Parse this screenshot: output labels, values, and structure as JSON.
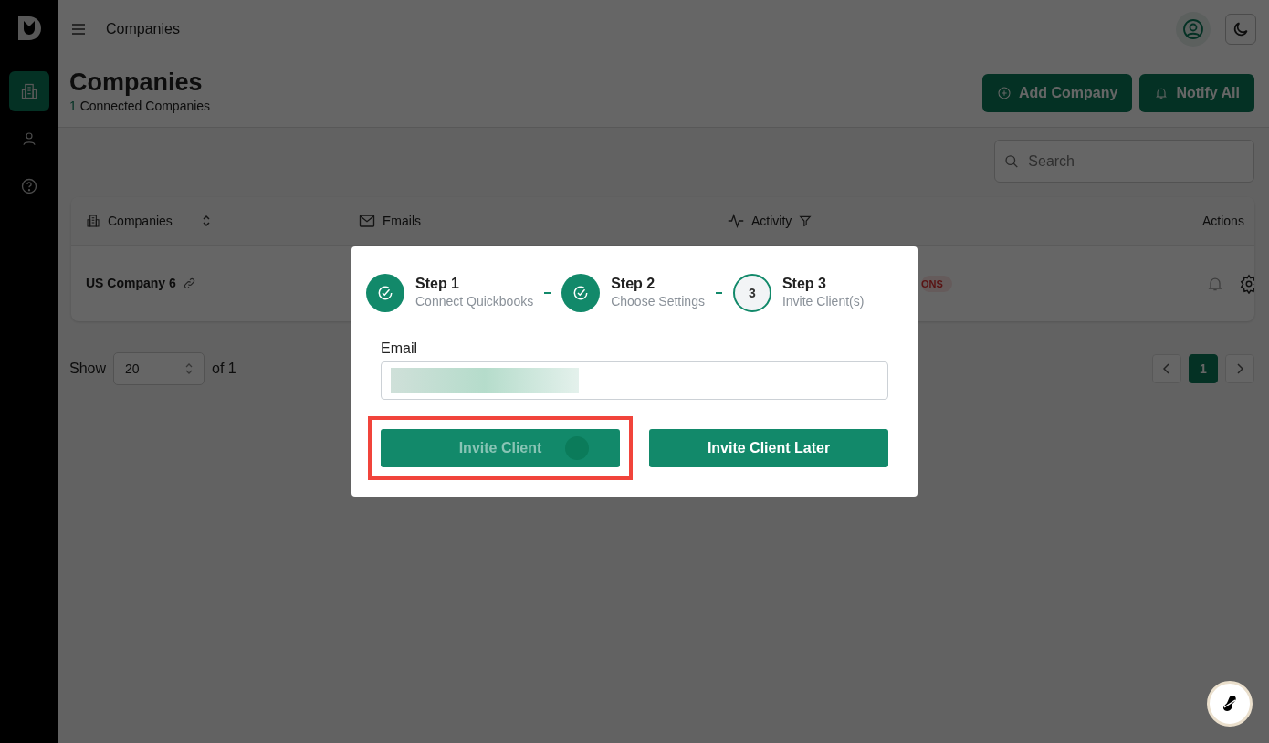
{
  "sidebar": {
    "items": [
      {
        "selected": true
      },
      {
        "selected": false
      },
      {
        "selected": false
      }
    ]
  },
  "topbar": {
    "title": "Companies"
  },
  "header": {
    "title": "Companies",
    "count": "1",
    "count_label": "Connected Companies",
    "buttons": [
      "Add Company",
      "Notify All"
    ]
  },
  "search": {
    "placeholder": "Search"
  },
  "table": {
    "columns": [
      "Companies",
      "Emails",
      "Activity",
      "Actions"
    ],
    "rows": [
      {
        "company": "US Company 6",
        "activity_badge": "ONS"
      }
    ]
  },
  "pagination": {
    "show_label": "Show",
    "page_size": "20",
    "of_label": "of 1",
    "pages": [
      {
        "label": "1",
        "selected": true
      }
    ]
  },
  "modal": {
    "steps": [
      {
        "title": "Step 1",
        "subtitle": "Connect Quickbooks",
        "completed": true
      },
      {
        "title": "Step 2",
        "subtitle": "Choose Settings",
        "completed": true
      },
      {
        "title": "Step 3",
        "subtitle": "Invite Client(s)",
        "completed": false,
        "number": "3"
      }
    ],
    "email_label": "Email",
    "buttons": [
      {
        "label": "Invite Client",
        "loading": true,
        "highlighted": true
      },
      {
        "label": "Invite Client Later",
        "loading": false,
        "highlighted": false
      }
    ]
  }
}
